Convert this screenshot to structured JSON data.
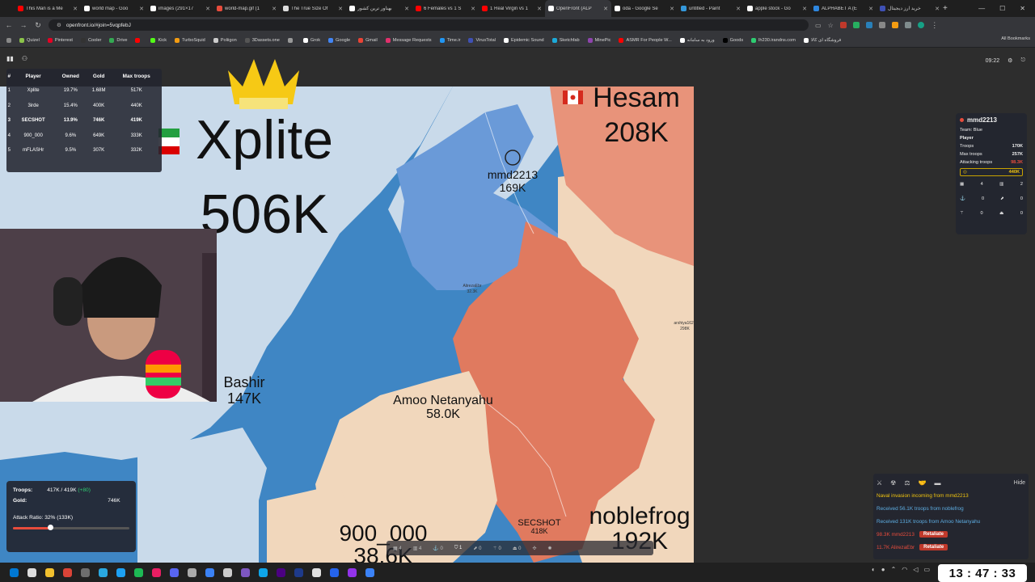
{
  "browser": {
    "tabs": [
      {
        "title": "This Man is a Me",
        "color": "#ff0000",
        "active": false
      },
      {
        "title": "world map - Goo",
        "color": "#ffffff",
        "active": false
      },
      {
        "title": "images (291×17",
        "color": "#ffffff",
        "active": false
      },
      {
        "title": "world-map.gif (1",
        "color": "#e74c3c",
        "active": false
      },
      {
        "title": "The True Size Of",
        "color": "#dddddd",
        "active": false
      },
      {
        "title": "بهناور ترین کشور",
        "color": "#ffffff",
        "active": false
      },
      {
        "title": "6 Females vs 1 S",
        "color": "#ff0000",
        "active": false
      },
      {
        "title": "1 Real Virgin vs 1",
        "color": "#ff0000",
        "active": false
      },
      {
        "title": "OpenFront (ALP",
        "color": "#ffffff",
        "active": true
      },
      {
        "title": "oda - Google Se",
        "color": "#ffffff",
        "active": false
      },
      {
        "title": "untitled - Paint",
        "color": "#3498db",
        "active": false
      },
      {
        "title": "apple stock - Go",
        "color": "#ffffff",
        "active": false
      },
      {
        "title": "ALPHABET A (E",
        "color": "#2e86de",
        "active": false
      },
      {
        "title": "خرید ارز دیجیتال",
        "color": "#3f51b5",
        "active": false
      }
    ],
    "url": "openfront.io/#join=5vqpfebJ",
    "bookmarks": [
      {
        "label": "Quizel",
        "color": "#8bc34a"
      },
      {
        "label": "Pinterest",
        "color": "#e60023"
      },
      {
        "label": "Cooler",
        "color": "#333333"
      },
      {
        "label": "Drive",
        "color": "#34a853"
      },
      {
        "label": "",
        "color": "#ff0000"
      },
      {
        "label": "Kick",
        "color": "#53fc18"
      },
      {
        "label": "TurboSquid",
        "color": "#f39c12"
      },
      {
        "label": "Poliigon",
        "color": "#cccccc"
      },
      {
        "label": "3Dassets.one",
        "color": "#555555"
      },
      {
        "label": "",
        "color": "#999999"
      },
      {
        "label": "Grok",
        "color": "#ffffff"
      },
      {
        "label": "Google",
        "color": "#4285f4"
      },
      {
        "label": "Gmail",
        "color": "#ea4335"
      },
      {
        "label": "Message Requests",
        "color": "#e1306c"
      },
      {
        "label": "Time.ir",
        "color": "#2196f3"
      },
      {
        "label": "VirusTotal",
        "color": "#3f51b5"
      },
      {
        "label": "Epidemic Sound",
        "color": "#ffffff"
      },
      {
        "label": "Sketchfab",
        "color": "#1caad9"
      },
      {
        "label": "MinePic",
        "color": "#8e44ad"
      },
      {
        "label": "ASMR For People W...",
        "color": "#ff0000"
      },
      {
        "label": "ورود به سامانه",
        "color": "#ffffff"
      },
      {
        "label": "Goods",
        "color": "#000000"
      },
      {
        "label": "lh230.irandns.com",
        "color": "#2ecc71"
      },
      {
        "label": "فروشگاه ای کالا",
        "color": "#ffffff"
      }
    ],
    "all_bookmarks": "All Bookmarks"
  },
  "game": {
    "timer": "09:22",
    "leaderboard": {
      "headers": [
        "#",
        "Player",
        "Owned",
        "Gold",
        "Max troops"
      ],
      "rows": [
        [
          "1",
          "Xplite",
          "19.7%",
          "1.68M",
          "517K"
        ],
        [
          "2",
          "3irde",
          "15.4%",
          "400K",
          "440K"
        ],
        [
          "3",
          "SECSHOT",
          "13.9%",
          "746K",
          "419K"
        ],
        [
          "4",
          "900_000",
          "9.6%",
          "649K",
          "333K"
        ],
        [
          "5",
          "mFLASHr",
          "9.5%",
          "307K",
          "332K"
        ]
      ]
    },
    "map_labels": {
      "xplite_name": "Xplite",
      "xplite_troops": "506K",
      "hesam_name": "Hesam",
      "hesam_troops": "208K",
      "mmd_name": "mmd2213",
      "mmd_troops": "169K",
      "bashir_name": "Bashir",
      "bashir_troops": "147K",
      "amoo_name": "Amoo Netanyahu",
      "amoo_troops": "58.0K",
      "p900_name": "900_000",
      "p900_troops": "38.6K",
      "noble_name": "noblefrog",
      "noble_troops": "192K",
      "sec_name": "SECSHOT",
      "sec_troops": "418K",
      "alireza_name": "AlirezaEbr",
      "alireza_troops": "32.3K",
      "arshiya_name": "arshiya1624",
      "arshiya_troops": "298K"
    },
    "player_info": {
      "name": "mmd2213",
      "team": "Team: Blue",
      "role": "Player",
      "troops_label": "Troops",
      "troops": "170K",
      "max_label": "Max troops",
      "max": "257K",
      "attacking_label": "Attacking troops",
      "attacking": "98.3K",
      "gold": "440K",
      "counts": [
        "4",
        "2",
        "0",
        "0",
        "0",
        "0"
      ]
    },
    "stats": {
      "troops_label": "Troops:",
      "troops_value": "417K / 419K",
      "troops_gain": "(+80)",
      "gold_label": "Gold:",
      "gold_value": "746K",
      "attack_ratio": "Attack Ratio: 32% (133K)",
      "attack_ratio_fraction": 0.32
    },
    "events": {
      "hide": "Hide",
      "items": [
        {
          "text": "Naval invasion incoming from mmd2213",
          "color": "#f1c40f",
          "button": ""
        },
        {
          "text": "Received 56.1K troops from noblefrog",
          "color": "#5dade2",
          "button": ""
        },
        {
          "text": "Received 131K troops from Amoo Netanyahu",
          "color": "#5dade2",
          "button": ""
        },
        {
          "text": "98.3K mmd2213",
          "color": "#e74c3c",
          "button": "Retaliate"
        },
        {
          "text": "11.7K AlirezaEbr",
          "color": "#e74c3c",
          "button": "Retaliate"
        }
      ]
    },
    "buildbar": [
      "4",
      "4",
      "0",
      "1",
      "0",
      "0",
      "0"
    ]
  },
  "taskbar": {
    "clock": "13 : 47 : 33"
  },
  "colors": {
    "ocean": "#3f86c4",
    "blue_territory": "#6a9ad8",
    "red_territory": "#e07a5f",
    "tan_territory": "#f1d7bc",
    "light_land": "#c9daea"
  }
}
